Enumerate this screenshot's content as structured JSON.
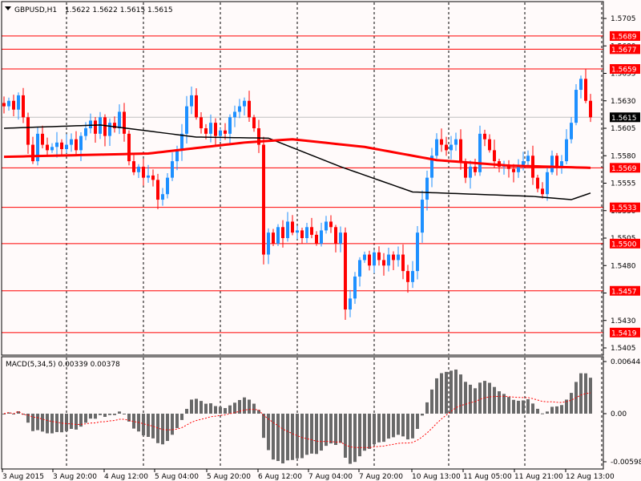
{
  "chart_data": {
    "type": "candlestick",
    "symbol": "GBPUSD,H1",
    "header_values": "1.5622 1.5622 1.5615 1.5615",
    "colors": {
      "bull": "#1e90ff",
      "bear": "#ff0000",
      "level": "#ff0000",
      "ma_red": "#ff0000",
      "ma_black": "#000000",
      "hist": "#696969"
    },
    "ylim": [
      1.54,
      1.5711
    ],
    "y_ticks": [
      "1.5705",
      "1.5680",
      "1.5655",
      "1.5630",
      "1.5605",
      "1.5580",
      "1.5555",
      "1.5530",
      "1.5505",
      "1.5480",
      "1.5455",
      "1.5430",
      "1.5405"
    ],
    "current_price": "1.5615",
    "levels": [
      "1.5689",
      "1.5677",
      "1.5659",
      "1.5569",
      "1.5533",
      "1.5500",
      "1.5457",
      "1.5419"
    ],
    "x_labels": [
      "3 Aug 2015",
      "3 Aug 20:00",
      "4 Aug 12:00",
      "5 Aug 04:00",
      "5 Aug 20:00",
      "6 Aug 12:00",
      "7 Aug 04:00",
      "7 Aug 20:00",
      "10 Aug 13:00",
      "11 Aug 05:00",
      "11 Aug 21:00",
      "12 Aug 13:00"
    ],
    "closes": [
      1.5625,
      1.563,
      1.5622,
      1.5635,
      1.5615,
      1.559,
      1.5575,
      1.56,
      1.559,
      1.5585,
      1.5588,
      1.5592,
      1.5586,
      1.559,
      1.5595,
      1.5585,
      1.5598,
      1.5605,
      1.5612,
      1.56,
      1.5615,
      1.5598,
      1.561,
      1.5605,
      1.562,
      1.56,
      1.5575,
      1.5565,
      1.557,
      1.556,
      1.5562,
      1.5558,
      1.554,
      1.5545,
      1.556,
      1.5575,
      1.5585,
      1.56,
      1.5625,
      1.5635,
      1.5615,
      1.5605,
      1.56,
      1.561,
      1.5598,
      1.5603,
      1.56,
      1.5615,
      1.562,
      1.5625,
      1.563,
      1.5615,
      1.5605,
      1.559,
      1.549,
      1.551,
      1.55,
      1.5515,
      1.5505,
      1.552,
      1.551,
      1.5512,
      1.5505,
      1.5515,
      1.5508,
      1.55,
      1.5512,
      1.552,
      1.5515,
      1.55,
      1.551,
      1.544,
      1.545,
      1.547,
      1.5485,
      1.549,
      1.548,
      1.5492,
      1.5485,
      1.548,
      1.549,
      1.5485,
      1.549,
      1.5475,
      1.5465,
      1.5475,
      1.551,
      1.554,
      1.556,
      1.558,
      1.5595,
      1.559,
      1.5585,
      1.559,
      1.5595,
      1.5575,
      1.556,
      1.557,
      1.5565,
      1.56,
      1.5595,
      1.5585,
      1.5575,
      1.557,
      1.5572,
      1.5568,
      1.5565,
      1.557,
      1.5575,
      1.558,
      1.556,
      1.555,
      1.5545,
      1.5565,
      1.558,
      1.557,
      1.5575,
      1.5595,
      1.561,
      1.564,
      1.565,
      1.563,
      1.5615
    ],
    "ma_red": [
      [
        0,
        1.5579
      ],
      [
        30,
        1.5582
      ],
      [
        50,
        1.5592
      ],
      [
        60,
        1.5595
      ],
      [
        75,
        1.5588
      ],
      [
        90,
        1.5576
      ],
      [
        105,
        1.5571
      ],
      [
        122,
        1.5569
      ]
    ],
    "ma_black": [
      [
        0,
        1.5605
      ],
      [
        20,
        1.5608
      ],
      [
        40,
        1.5597
      ],
      [
        55,
        1.5596
      ],
      [
        70,
        1.557
      ],
      [
        85,
        1.5547
      ],
      [
        110,
        1.5543
      ],
      [
        118,
        1.554
      ],
      [
        122,
        1.5546
      ]
    ],
    "macd": {
      "label": "MACD(5,34,5) 0.00339 0.00378",
      "ylim": [
        -0.00598,
        0.00644
      ],
      "y_ticks": [
        "0.00644",
        "0.00",
        "-0.00598"
      ]
    }
  }
}
